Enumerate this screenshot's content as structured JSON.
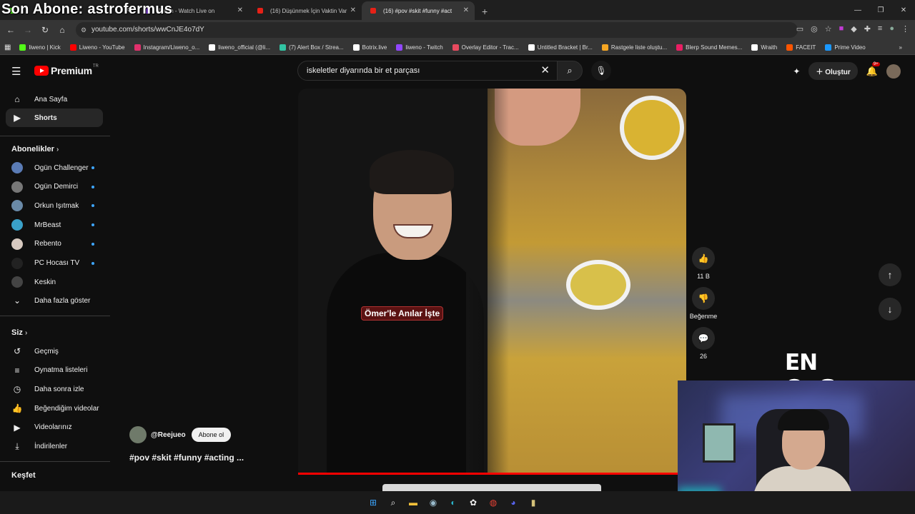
{
  "browser": {
    "tabs": [
      {
        "title": "Son Abone: astrofermus",
        "active": false
      },
      {
        "title": "Twitch - Watch Live on",
        "active": false
      },
      {
        "title": "(16) Düşünmek İçin Vaktin Var",
        "active": false
      },
      {
        "title": "(16) #pov #skit #funny #act",
        "active": true
      }
    ],
    "url": "youtube.com/shorts/wwCnJE4o7dY",
    "bookmarks": [
      {
        "label": "liweno | Kick",
        "color": "#53fc18"
      },
      {
        "label": "Liweno - YouTube",
        "color": "#ff0000"
      },
      {
        "label": "Instagram/Liweno_o...",
        "color": "#e1306c"
      },
      {
        "label": "liweno_official (@li...",
        "color": "#ffffff"
      },
      {
        "label": "(7) Alert Box / Strea...",
        "color": "#31c3a2"
      },
      {
        "label": "Botrix.live",
        "color": "#ffffff"
      },
      {
        "label": "liweno - Twitch",
        "color": "#9146ff"
      },
      {
        "label": "Overlay Editor - Trac...",
        "color": "#e84a5f"
      },
      {
        "label": "Untitled Bracket | Br...",
        "color": "#ffffff"
      },
      {
        "label": "Rastgele liste oluştu...",
        "color": "#f5a623"
      },
      {
        "label": "Blerp Sound Memes...",
        "color": "#e91e63"
      },
      {
        "label": "Wraith",
        "color": "#ffffff"
      },
      {
        "label": "FACEIT",
        "color": "#ff5500"
      },
      {
        "label": "Prime Video",
        "color": "#1a98ff"
      }
    ]
  },
  "overlay": {
    "stream_title": "Son Abone: astrofermus",
    "watermark": "EN OoGame"
  },
  "header": {
    "logo_text": "Premium",
    "logo_region": "TR",
    "search_value": "iskeletler diyarında bir et parçası",
    "create_label": "Oluştur",
    "notification_count": "9+"
  },
  "sidebar": {
    "main": [
      {
        "label": "Ana Sayfa",
        "icon": "home-icon",
        "active": false
      },
      {
        "label": "Shorts",
        "icon": "shorts-icon",
        "active": true
      }
    ],
    "subscriptions_title": "Abonelikler",
    "subscriptions": [
      {
        "label": "Ogün Challenger",
        "color": "#5a7bb5"
      },
      {
        "label": "Ogün Demirci",
        "color": "#777777"
      },
      {
        "label": "Orkun Işıtmak",
        "color": "#6a8aa8"
      },
      {
        "label": "MrBeast",
        "color": "#3aa1c9"
      },
      {
        "label": "Rebento",
        "color": "#d7c9c0"
      },
      {
        "label": "PC Hocası TV",
        "color": "#222222"
      },
      {
        "label": "Keskin",
        "color": "#444444"
      }
    ],
    "show_more": "Daha fazla göster",
    "you_title": "Siz",
    "you_items": [
      {
        "label": "Geçmiş",
        "icon": "history-icon"
      },
      {
        "label": "Oynatma listeleri",
        "icon": "playlist-icon"
      },
      {
        "label": "Daha sonra izle",
        "icon": "clock-icon"
      },
      {
        "label": "Beğendiğim videolar",
        "icon": "like-icon"
      },
      {
        "label": "Videolarınız",
        "icon": "video-icon"
      },
      {
        "label": "İndirilenler",
        "icon": "download-icon"
      }
    ],
    "explore_title": "Keşfet"
  },
  "short": {
    "caption": "Ömer'le Anılar İşte",
    "channel_handle": "@Reejueo",
    "subscribe_label": "Abone ol",
    "title": "#pov #skit #funny #acting ...",
    "progress": 1.0,
    "likes": "11 B",
    "dislike_label": "Beğenme",
    "comments": "26"
  }
}
